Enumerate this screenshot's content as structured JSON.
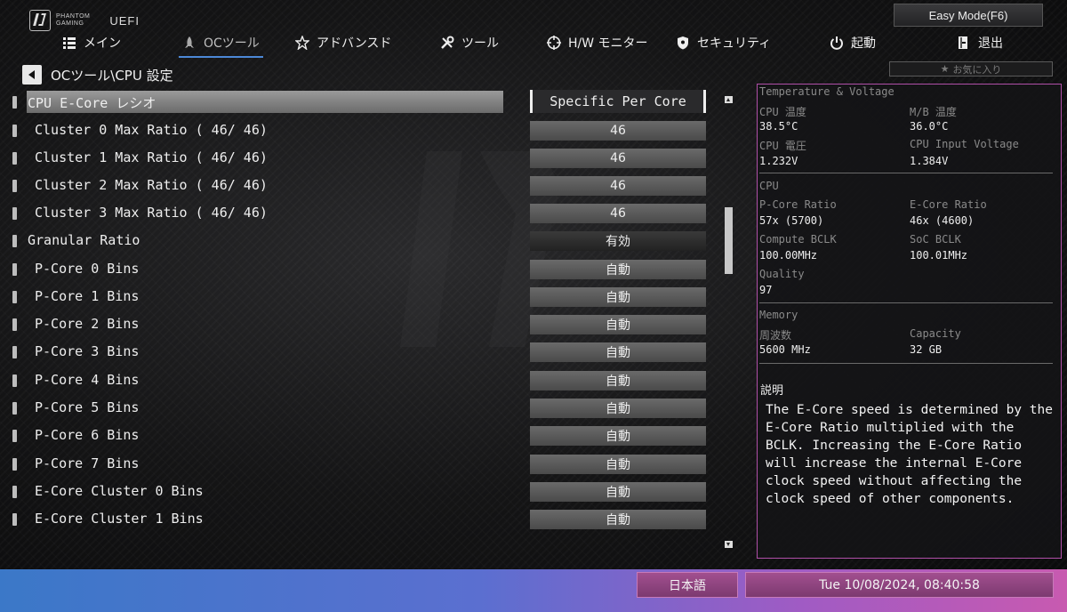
{
  "header": {
    "brand_line1": "PHANTOM",
    "brand_line2": "GAMING",
    "uefi_label": "UEFI",
    "easy_mode_label": "Easy Mode(F6)",
    "favorites_label": "お気に入り"
  },
  "nav": {
    "items": [
      {
        "label": "メイン",
        "icon": "list-icon"
      },
      {
        "label": "OCツール",
        "icon": "rocket-icon"
      },
      {
        "label": "アドバンスド",
        "icon": "star-icon"
      },
      {
        "label": "ツール",
        "icon": "tools-icon"
      },
      {
        "label": "H/W モニター",
        "icon": "crosshair-icon"
      },
      {
        "label": "セキュリティ",
        "icon": "shield-icon"
      },
      {
        "label": "起動",
        "icon": "power-icon"
      },
      {
        "label": "退出",
        "icon": "exit-icon"
      }
    ],
    "active": "OCツール",
    "accent_color": "#4c88d6"
  },
  "breadcrumb": "OCツール\\CPU 設定",
  "settings": [
    {
      "label": "CPU E-Core レシオ",
      "value": "Specific Per Core",
      "selected": true
    },
    {
      "label": "Cluster 0 Max Ratio ( 46/ 46)",
      "value": "46"
    },
    {
      "label": "Cluster 1 Max Ratio ( 46/ 46)",
      "value": "46"
    },
    {
      "label": "Cluster 2 Max Ratio ( 46/ 46)",
      "value": "46"
    },
    {
      "label": "Cluster 3 Max Ratio ( 46/ 46)",
      "value": "46"
    },
    {
      "label": "Granular Ratio",
      "value": "有効"
    },
    {
      "label": "P-Core 0 Bins",
      "value": "自動"
    },
    {
      "label": "P-Core 1 Bins",
      "value": "自動"
    },
    {
      "label": "P-Core 2 Bins",
      "value": "自動"
    },
    {
      "label": "P-Core 3 Bins",
      "value": "自動"
    },
    {
      "label": "P-Core 4 Bins",
      "value": "自動"
    },
    {
      "label": "P-Core 5 Bins",
      "value": "自動"
    },
    {
      "label": "P-Core 6 Bins",
      "value": "自動"
    },
    {
      "label": "P-Core 7 Bins",
      "value": "自動"
    },
    {
      "label": "E-Core Cluster 0 Bins",
      "value": "自動"
    },
    {
      "label": "E-Core Cluster 1 Bins",
      "value": "自動"
    }
  ],
  "monitor": {
    "section_title": "Temperature & Voltage",
    "cpu_temp_label": "CPU 温度",
    "cpu_temp_value": "38.5°C",
    "mb_temp_label": "M/B 温度",
    "mb_temp_value": "36.0°C",
    "cpu_voltage_label": "CPU 電圧",
    "cpu_voltage_value": "1.232V",
    "cpu_input_voltage_label": "CPU Input Voltage",
    "cpu_input_voltage_value": "1.384V",
    "cpu_section": "CPU",
    "pcore_ratio_label": "P-Core Ratio",
    "pcore_ratio_value": "57x (5700)",
    "ecore_ratio_label": "E-Core Ratio",
    "ecore_ratio_value": "46x (4600)",
    "compute_bclk_label": "Compute BCLK",
    "compute_bclk_value": "100.00MHz",
    "soc_bclk_label": "SoC BCLK",
    "soc_bclk_value": "100.01MHz",
    "quality_label": "Quality",
    "quality_value": "97",
    "memory_section": "Memory",
    "freq_label": "周波数",
    "freq_value": "5600 MHz",
    "capacity_label": "Capacity",
    "capacity_value": "32 GB"
  },
  "description": {
    "title": "説明",
    "text": "The E-Core speed is determined by the E-Core Ratio multiplied with the BCLK. Increasing the E-Core Ratio will increase the internal E-Core clock speed without affecting the clock speed of other components."
  },
  "footer": {
    "language": "日本語",
    "datetime": "Tue 10/08/2024, 08:40:58"
  }
}
